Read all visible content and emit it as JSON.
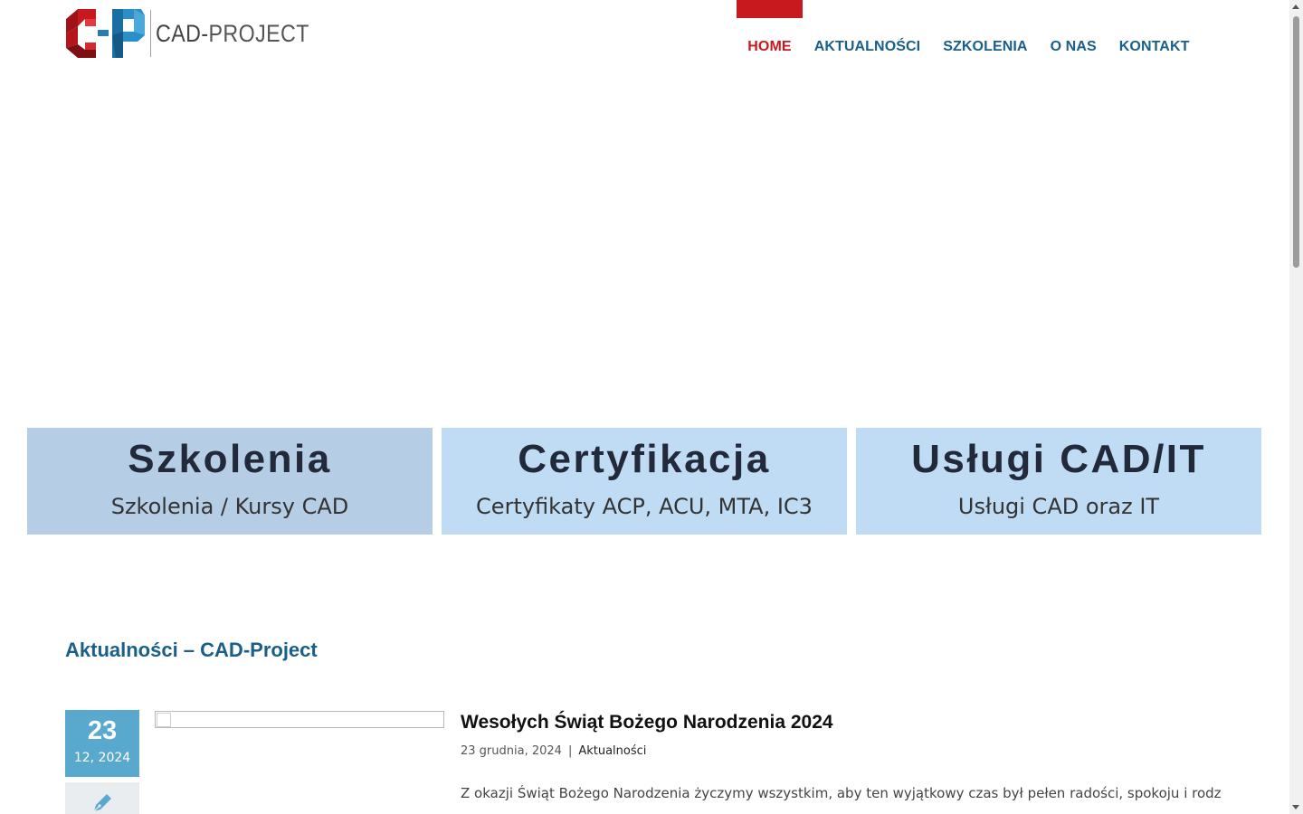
{
  "brand": {
    "name_main": "CAD",
    "name_sep": "-",
    "name_rest": "PROJECT",
    "colors": {
      "red": "#c8191f",
      "blue": "#1a5e8a",
      "light_blue": "#59a9cf"
    }
  },
  "nav": {
    "items": [
      {
        "label": "HOME",
        "active": true
      },
      {
        "label": "AKTUALNOŚCI",
        "active": false
      },
      {
        "label": "SZKOLENIA",
        "active": false
      },
      {
        "label": "O NAS",
        "active": false
      },
      {
        "label": "KONTAKT",
        "active": false
      }
    ]
  },
  "features": [
    {
      "title": "Szkolenia",
      "subtitle": "Szkolenia / Kursy CAD"
    },
    {
      "title": "Certyfikacja",
      "subtitle": "Certyfikaty ACP, ACU, MTA, IC3"
    },
    {
      "title": "Usługi CAD/IT",
      "subtitle": "Usługi CAD oraz IT"
    }
  ],
  "news": {
    "heading": "Aktualności – CAD-Project",
    "posts": [
      {
        "day": "23",
        "month_year": "12, 2024",
        "title": "Wesołych Świąt Bożego Narodzenia 2024",
        "date": "23 grudnia, 2024",
        "meta_sep": "|",
        "category": "Aktualności",
        "excerpt": "Z okazji Świąt Bożego Narodzenia życzymy wszystkim, aby ten wyjątkowy czas był pełen radości, spokoju i rodzinnego",
        "format_icon": "pen-icon"
      }
    ]
  }
}
